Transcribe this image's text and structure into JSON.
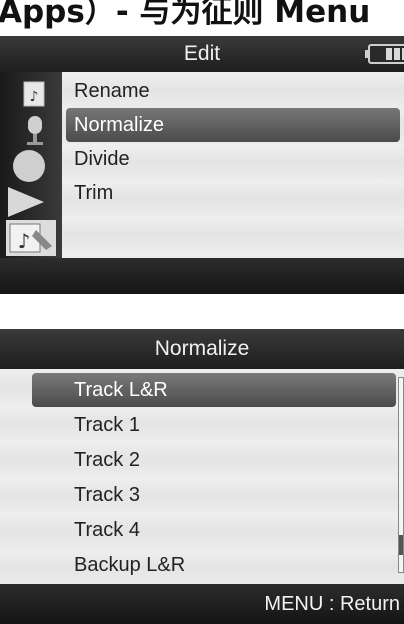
{
  "caption": {
    "text": "Apps）- 与为征则 Menu"
  },
  "screen1": {
    "title": "Edit",
    "battery_level": 0.75,
    "sidebar_icons": [
      "file-icon",
      "microphone-icon",
      "record-icon",
      "play-icon",
      "music-edit-icon"
    ],
    "items": [
      {
        "label": "Rename",
        "selected": false
      },
      {
        "label": "Normalize",
        "selected": true
      },
      {
        "label": "Divide",
        "selected": false
      },
      {
        "label": "Trim",
        "selected": false
      }
    ]
  },
  "screen2": {
    "title": "Normalize",
    "items": [
      {
        "label": "Track L&R",
        "selected": true
      },
      {
        "label": "Track 1",
        "selected": false
      },
      {
        "label": "Track 2",
        "selected": false
      },
      {
        "label": "Track 3",
        "selected": false
      },
      {
        "label": "Track 4",
        "selected": false
      },
      {
        "label": "Backup L&R",
        "selected": false
      }
    ],
    "footer": "MENU : Return",
    "scroll_position": 0.9,
    "scroll_visible_fraction": 0.1
  }
}
